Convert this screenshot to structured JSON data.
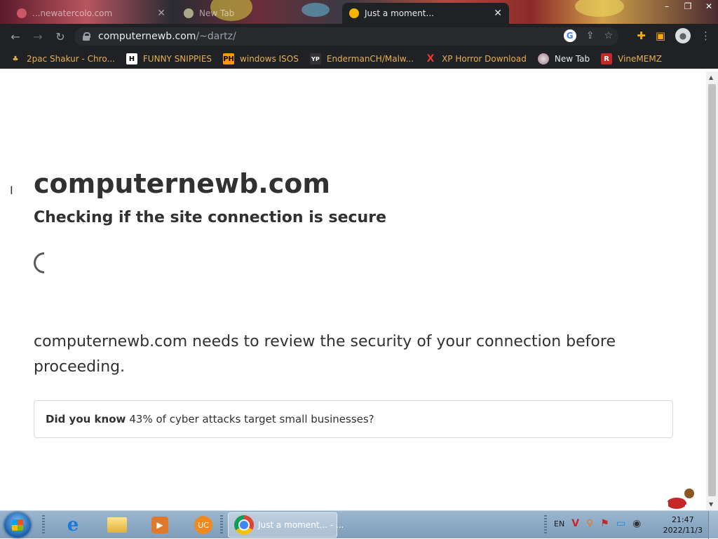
{
  "browser": {
    "tabs": [
      {
        "title": "...newatercolo.com",
        "active": false
      },
      {
        "title": "New Tab",
        "active": false
      },
      {
        "title": "Just a moment...",
        "active": true
      }
    ],
    "url_host": "computernewb.com",
    "url_path": "/~dartz/",
    "bookmarks": [
      {
        "label": "2pac Shakur - Chro...",
        "icon": "music-icon",
        "color": "#e8b04a"
      },
      {
        "label": "FUNNY SNIPPIES",
        "icon": "H",
        "color": "#e8b04a"
      },
      {
        "label": "windows ISOS",
        "icon": "PH",
        "color": "#e8b04a"
      },
      {
        "label": "EndermanCH/Malw...",
        "icon": "YP",
        "color": "#e8b04a"
      },
      {
        "label": "XP Horror Download",
        "icon": "X",
        "color": "#e8b04a"
      },
      {
        "label": "New Tab",
        "icon": "globe-icon",
        "color": "#e8eaed"
      },
      {
        "label": "VineMEMZ",
        "icon": "R",
        "color": "#e8b04a"
      }
    ]
  },
  "page": {
    "site_title": "computernewb.com",
    "subtitle": "Checking if the site connection is secure",
    "review_text": "computernewb.com needs to review the security of your connection before proceeding.",
    "did_you_know_label": "Did you know",
    "did_you_know_text": "43% of cyber attacks target small businesses?"
  },
  "taskbar": {
    "chrome_task_label": "Just a moment... - ...",
    "language": "EN",
    "time": "21:47",
    "date": "2022/11/3"
  },
  "colors": {
    "page_text": "#313131",
    "chrome_dark": "#202124",
    "bookmark_text": "#e8b04a"
  }
}
